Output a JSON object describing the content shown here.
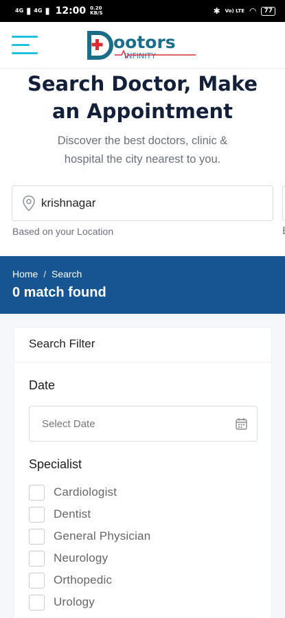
{
  "status": {
    "signal1": "4G",
    "signal2": "4G",
    "time": "12:00",
    "speed_value": "0.20",
    "speed_unit": "KB/S",
    "network": "Vo) LTE",
    "battery": "77"
  },
  "header": {
    "logo_text_main": "Doctors",
    "logo_text_sub": "INFINITY",
    "menu_icon": "hamburger-icon"
  },
  "hero": {
    "title_line1": "Search Doctor, Make",
    "title_line2": "an Appointment",
    "subtitle_line1": "Discover the best doctors, clinic &",
    "subtitle_line2": "hospital the city nearest to you."
  },
  "location": {
    "value": "krishnagar",
    "hint": "Based on your Location",
    "hint_partial": "B"
  },
  "breadcrumb": {
    "home": "Home",
    "separator": "/",
    "current": "Search",
    "match_text": "0 match found"
  },
  "filter": {
    "title": "Search Filter",
    "date_label": "Date",
    "date_placeholder": "Select Date",
    "specialist_label": "Specialist",
    "specialists": [
      "Cardiologist",
      "Dentist",
      "General Physician",
      "Neurology",
      "Orthopedic",
      "Urology"
    ]
  },
  "colors": {
    "brand_blue": "#165591",
    "accent_cyan": "#20c0e0",
    "logo_teal": "#1b6e8a",
    "logo_red": "#e02a2f"
  }
}
